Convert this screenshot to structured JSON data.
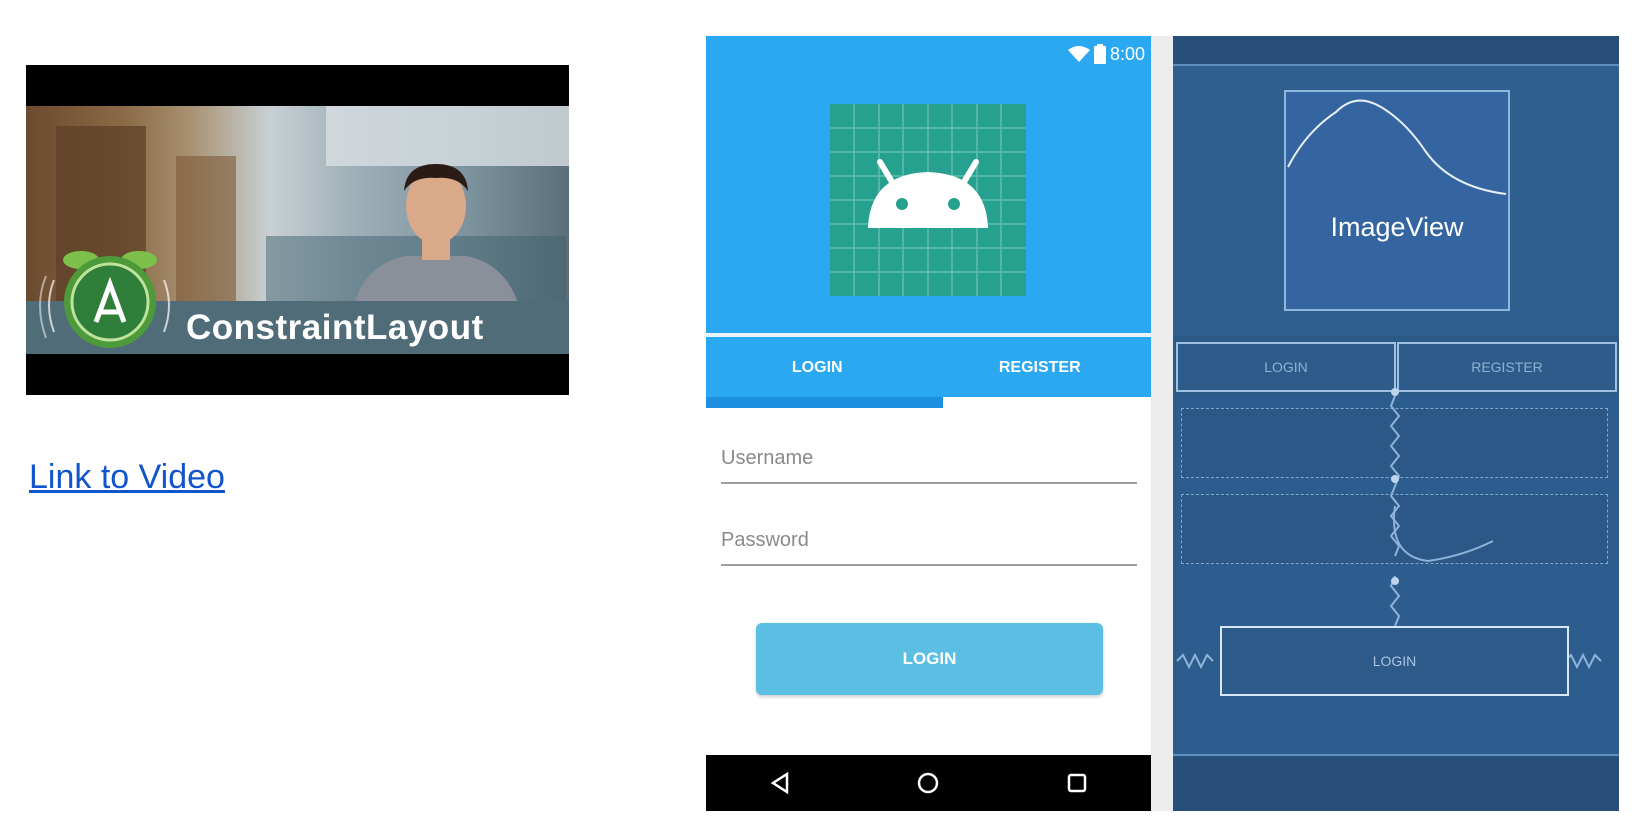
{
  "thumbnail": {
    "caption": "ConstraintLayout"
  },
  "link": {
    "text": "Link to Video"
  },
  "phone": {
    "status": {
      "time": "8:00"
    },
    "tabs": [
      {
        "label": "LOGIN",
        "selected": true
      },
      {
        "label": "REGISTER",
        "selected": false
      }
    ],
    "username": {
      "placeholder": "Username",
      "value": ""
    },
    "password": {
      "placeholder": "Password",
      "value": ""
    },
    "login_button": "LOGIN",
    "nav_icons": [
      "back-icon",
      "home-icon",
      "recents-icon"
    ]
  },
  "blueprint": {
    "image_label": "ImageView",
    "tabs": [
      "LOGIN",
      "REGISTER"
    ],
    "login_button": "LOGIN"
  },
  "colors": {
    "phone_accent": "#2aa8f2",
    "button": "#5bbfe3",
    "blueprint": "#2b5a86",
    "link": "#1155cc"
  }
}
